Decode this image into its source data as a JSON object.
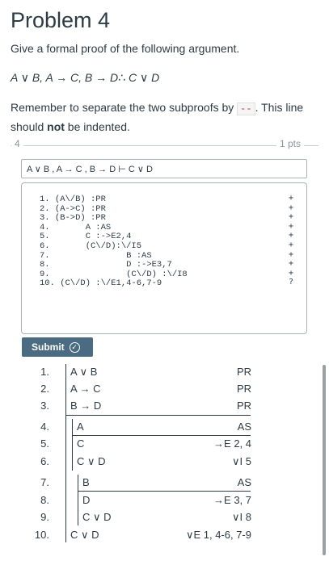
{
  "title": "Problem 4",
  "prompt": "Give a formal proof of the following argument.",
  "argument": "A ∨ B, A → C, B → D∴ C ∨ D",
  "remember": {
    "before": "Remember to separate the two subproofs by ",
    "code": "--",
    "middle": ". This line should ",
    "bold": "not",
    "after": " be indented."
  },
  "question": {
    "number": "4",
    "points": "1 pts",
    "argument_box": "A ∨ B , A → C , B → D ⊢ C ∨ D",
    "code_lines": [
      "1. (A\\/B) :PR",
      "2. (A->C) :PR",
      "3. (B->D) :PR",
      "4.       A :AS",
      "5.       C :->E2,4",
      "6.       (C\\/D):\\/I5",
      "7.               B :AS",
      "8.               D :->E3,7",
      "9.               (C\\/D) :\\/I8",
      "10. (C\\/D) :\\/E1,4-6,7-9"
    ],
    "line_marks": [
      "+",
      "+",
      "+",
      "+",
      "+",
      "+",
      "+",
      "+",
      "+",
      "?"
    ],
    "submit_label": "Submit",
    "submit_icon": "check-circle-icon"
  },
  "proof": [
    {
      "num": "1.",
      "formula": "A ∨ B",
      "just": "PR"
    },
    {
      "num": "2.",
      "formula": "A → C",
      "just": "PR"
    },
    {
      "num": "3.",
      "formula": "B → D",
      "just": "PR"
    },
    {
      "num": "4.",
      "formula": "A",
      "just": "AS"
    },
    {
      "num": "5.",
      "formula": "C",
      "just": "→E 2, 4"
    },
    {
      "num": "6.",
      "formula": "C ∨ D",
      "just": "∨I 5"
    },
    {
      "num": "7.",
      "formula": "B",
      "just": "AS"
    },
    {
      "num": "8.",
      "formula": "D",
      "just": "→E 3, 7"
    },
    {
      "num": "9.",
      "formula": "C ∨ D",
      "just": "∨I 8"
    },
    {
      "num": "10.",
      "formula": "C ∨ D",
      "just": "∨E 1, 4-6, 7-9"
    }
  ]
}
